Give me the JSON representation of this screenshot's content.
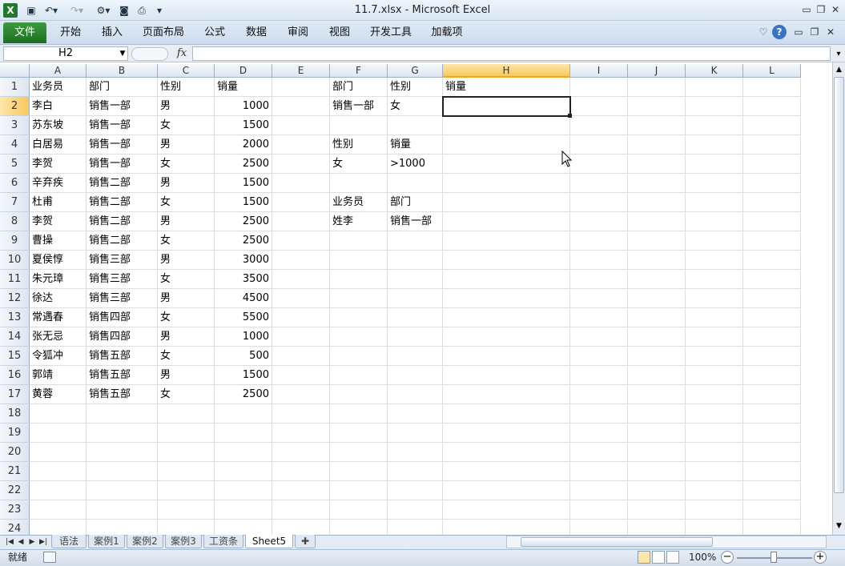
{
  "window": {
    "title": "11.7.xlsx  -  Microsoft Excel"
  },
  "ribbon_tabs": [
    "文件",
    "开始",
    "插入",
    "页面布局",
    "公式",
    "数据",
    "审阅",
    "视图",
    "开发工具",
    "加载项"
  ],
  "formula_bar": {
    "name_box": "H2",
    "fx_label": "fx",
    "formula": ""
  },
  "columns": [
    "A",
    "B",
    "C",
    "D",
    "E",
    "F",
    "G",
    "H",
    "I",
    "J",
    "K",
    "L"
  ],
  "rows": [
    "1",
    "2",
    "3",
    "4",
    "5",
    "6",
    "7",
    "8",
    "9",
    "10",
    "11",
    "12",
    "13",
    "14",
    "15",
    "16",
    "17",
    "18",
    "19",
    "20",
    "21",
    "22",
    "23",
    "24"
  ],
  "cells": {
    "A1": "业务员",
    "B1": "部门",
    "C1": "性别",
    "D1": "销量",
    "A2": "李白",
    "B2": "销售一部",
    "C2": "男",
    "D2": "1000",
    "A3": "苏东坡",
    "B3": "销售一部",
    "C3": "女",
    "D3": "1500",
    "A4": "白居易",
    "B4": "销售一部",
    "C4": "男",
    "D4": "2000",
    "A5": "李贺",
    "B5": "销售一部",
    "C5": "女",
    "D5": "2500",
    "A6": "辛弃疾",
    "B6": "销售二部",
    "C6": "男",
    "D6": "1500",
    "A7": "杜甫",
    "B7": "销售二部",
    "C7": "女",
    "D7": "1500",
    "A8": "李贺",
    "B8": "销售二部",
    "C8": "男",
    "D8": "2500",
    "A9": "曹操",
    "B9": "销售二部",
    "C9": "女",
    "D9": "2500",
    "A10": "夏侯惇",
    "B10": "销售三部",
    "C10": "男",
    "D10": "3000",
    "A11": "朱元璋",
    "B11": "销售三部",
    "C11": "女",
    "D11": "3500",
    "A12": "徐达",
    "B12": "销售三部",
    "C12": "男",
    "D12": "4500",
    "A13": "常遇春",
    "B13": "销售四部",
    "C13": "女",
    "D13": "5500",
    "A14": "张无忌",
    "B14": "销售四部",
    "C14": "男",
    "D14": "1000",
    "A15": "令狐冲",
    "B15": "销售五部",
    "C15": "女",
    "D15": "500",
    "A16": "郭靖",
    "B16": "销售五部",
    "C16": "男",
    "D16": "1500",
    "A17": "黄蓉",
    "B17": "销售五部",
    "C17": "女",
    "D17": "2500",
    "F1": "部门",
    "G1": "性别",
    "H1": "销量",
    "F2": "销售一部",
    "G2": "女",
    "F4": "性别",
    "G4": "销量",
    "F5": "女",
    "G5": ">1000",
    "F7": "业务员",
    "G7": "部门",
    "F8": "姓李",
    "G8": "销售一部"
  },
  "sheet_tabs": [
    "语法",
    "案例1",
    "案例2",
    "案例3",
    "工资条",
    "Sheet5"
  ],
  "active_sheet": "Sheet5",
  "status": {
    "ready": "就绪",
    "zoom": "100%"
  },
  "colors": {
    "file_tab": "#2a7d2b",
    "selected_header": "#f7c95e",
    "grid_line": "#dadfe6"
  }
}
